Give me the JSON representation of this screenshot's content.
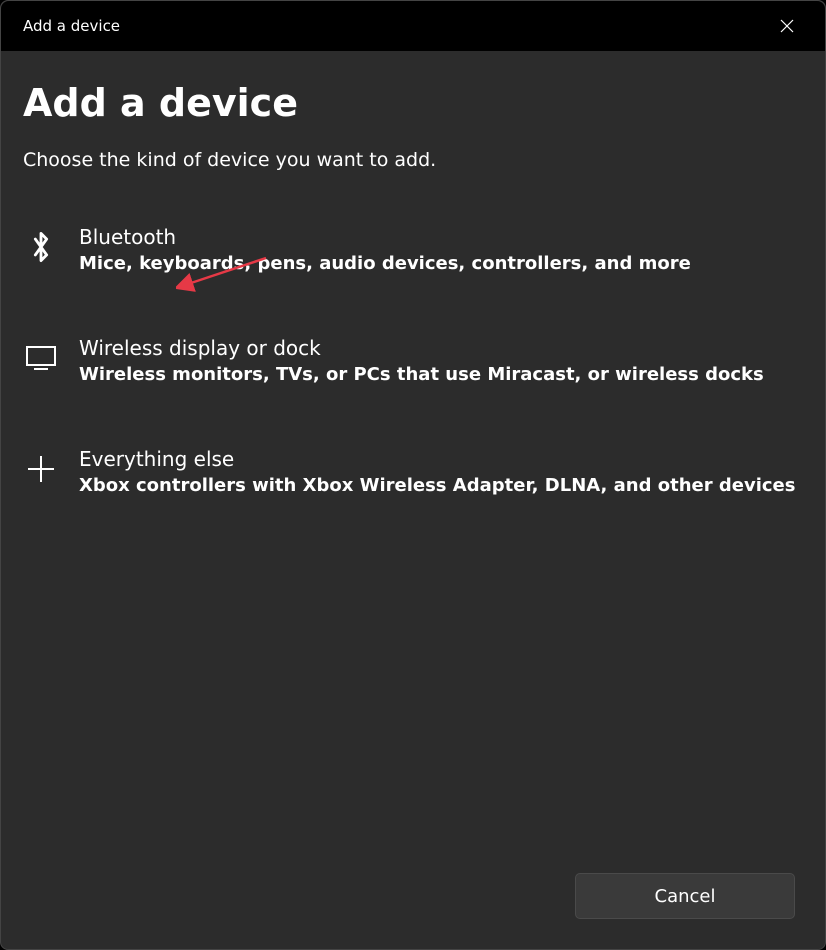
{
  "titlebar": {
    "title": "Add a device"
  },
  "header": {
    "title": "Add a device",
    "subtitle": "Choose the kind of device you want to add."
  },
  "options": {
    "bluetooth": {
      "title": "Bluetooth",
      "desc": "Mice, keyboards, pens, audio devices, controllers, and more"
    },
    "wireless": {
      "title": "Wireless display or dock",
      "desc": "Wireless monitors, TVs, or PCs that use Miracast, or wireless docks"
    },
    "everything": {
      "title": "Everything else",
      "desc": "Xbox controllers with Xbox Wireless Adapter, DLNA, and other devices"
    }
  },
  "footer": {
    "cancel_label": "Cancel"
  }
}
